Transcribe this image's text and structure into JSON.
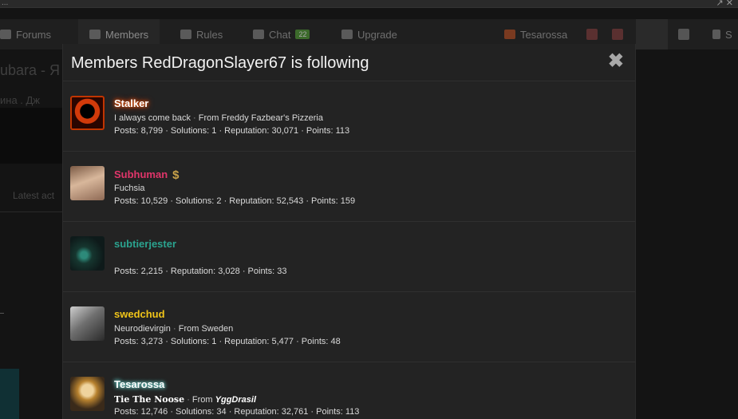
{
  "browser": {
    "title_fragment": "...",
    "right_glyphs": "↗ ✕"
  },
  "nav": {
    "forums": "Forums",
    "members": "Members",
    "rules": "Rules",
    "chat": "Chat",
    "chat_badge": "22",
    "upgrade": "Upgrade",
    "user": "Tesarossa",
    "search": "S"
  },
  "background": {
    "title_fragment": "ubara - Я",
    "sub_fragment": "ина . Дж",
    "latest": "Latest act"
  },
  "modal": {
    "title": "Members RedDragonSlayer67 is following",
    "close_glyph": "✖"
  },
  "members": [
    {
      "name": "Stalker",
      "tagline": "I always come back",
      "location_prefix": "From",
      "location": "Freddy Fazbear's Pizzeria",
      "stats": "Posts: 8,799 · Solutions: 1 · Reputation: 30,071 · Points: 113"
    },
    {
      "name": "Subhuman",
      "badge": "$",
      "tagline": "Fuchsia",
      "stats": "Posts: 10,529 · Solutions: 2 · Reputation: 52,543 · Points: 159"
    },
    {
      "name": "subtierjester",
      "stats": "Posts: 2,215 · Reputation: 3,028 · Points: 33"
    },
    {
      "name": "swedchud",
      "tagline": "Neurodievirgin",
      "location_prefix": "From",
      "location": "Sweden",
      "stats": "Posts: 3,273 · Solutions: 1 · Reputation: 5,477 · Points: 48"
    },
    {
      "name": "Tesarossa",
      "tagline": "Tie The Noose",
      "location_prefix": "From",
      "location": "YggDrasil",
      "stats": "Posts: 12,746 · Solutions: 34 · Reputation: 32,761 · Points: 113"
    }
  ],
  "colors": {
    "stalker": "#ff5a00",
    "subhuman": "#e0356a",
    "subtierjester": "#2ba38f",
    "swedchud": "#f0c419",
    "tesarossa_glow": "#7ad9d4"
  }
}
